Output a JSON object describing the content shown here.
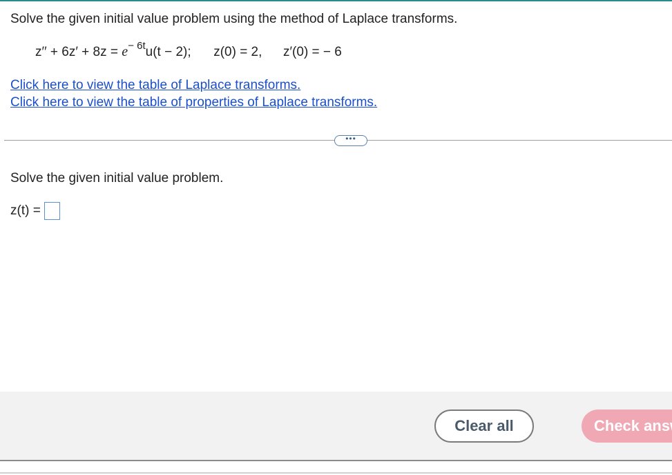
{
  "question": {
    "instruction": "Solve the given initial value problem using the method of Laplace transforms.",
    "equation": {
      "lhs": "z′′ + 6z′ + 8z =",
      "e": "e",
      "exponent": "− 6t",
      "rhs": "u(t − 2);",
      "ic1": "z(0) = 2,",
      "ic2": "z′(0) =  − 6"
    },
    "links": {
      "table_transforms": "Click here to view the table of Laplace transforms.",
      "table_properties": "Click here to view the table of properties of Laplace transforms."
    },
    "more_label": "•••"
  },
  "answer": {
    "prompt": "Solve the given initial value problem.",
    "label": "z(t) =",
    "value": ""
  },
  "footer": {
    "clear_label": "Clear all",
    "check_label": "Check answer"
  },
  "colors": {
    "link": "#1a4fc9",
    "check_button": "#f0a8b4",
    "top_accent": "#2e8a8a"
  }
}
